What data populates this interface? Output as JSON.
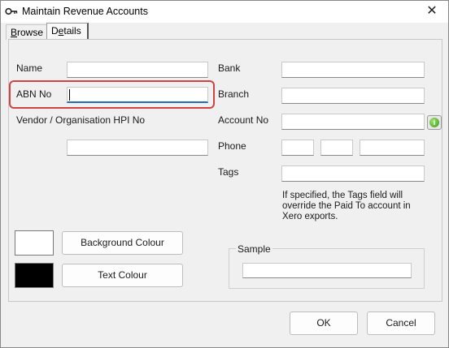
{
  "window": {
    "title": "Maintain Revenue Accounts",
    "close_glyph": "✕"
  },
  "tabs": [
    {
      "label": "Browse",
      "underline": "B",
      "rest": "rowse"
    },
    {
      "label": "Details",
      "pre": "D",
      "underline": "e",
      "rest": "tails"
    }
  ],
  "form": {
    "name_label": "Name",
    "abn_label": "ABN No",
    "vendor_label": "Vendor / Organisation HPI No",
    "bank_label": "Bank",
    "branch_label": "Branch",
    "account_label": "Account No",
    "phone_label": "Phone",
    "tags_label": "Tags",
    "tags_note": "If specified, the Tags field will override the Paid To account in Xero exports.",
    "name_value": "",
    "abn_value": "",
    "vendor_value": "",
    "bank_value": "",
    "branch_value": "",
    "account_value": "",
    "phone_1": "",
    "phone_2": "",
    "phone_3": "",
    "tags_value": "",
    "sample_value": ""
  },
  "colours": {
    "background_button": "Background Colour",
    "text_button": "Text Colour",
    "background_swatch": "#ffffff",
    "text_swatch": "#000000"
  },
  "sample": {
    "title": "Sample"
  },
  "footer": {
    "ok_label": "OK",
    "cancel_label": "Cancel"
  },
  "icons": {
    "app": "key-icon",
    "info": "green-info-icon"
  },
  "accent": {
    "focus": "#1f6fb8",
    "highlight": "#d04343"
  }
}
